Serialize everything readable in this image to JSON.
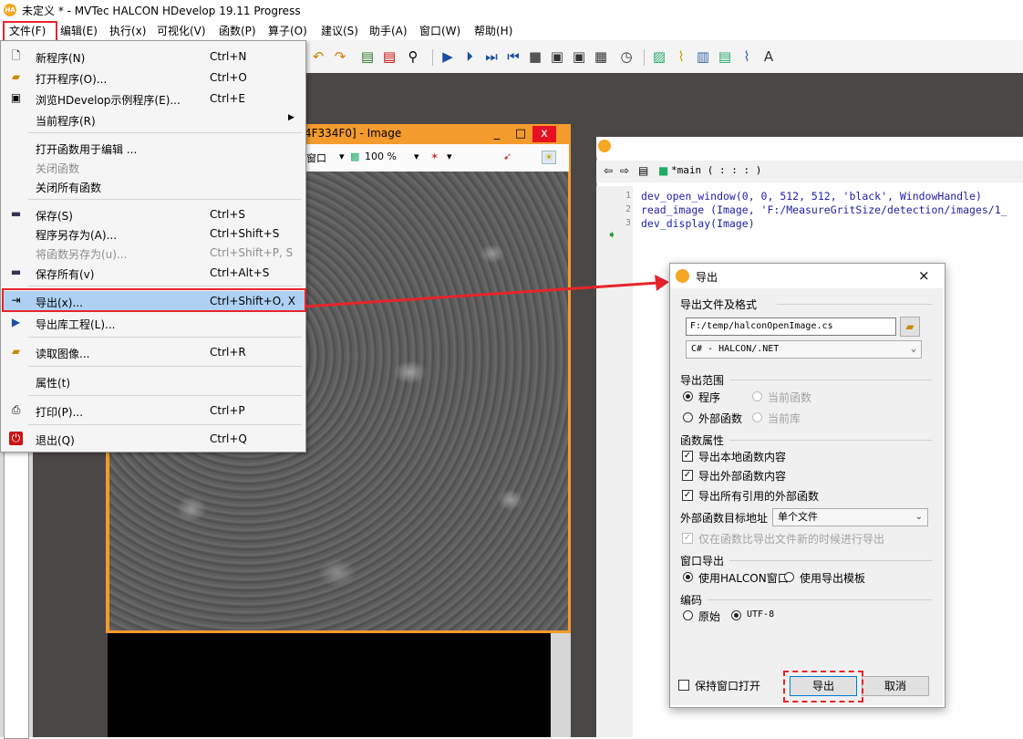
{
  "window": {
    "title": "未定义 * - MVTec HALCON HDevelop 19.11 Progress",
    "logo": "HA"
  },
  "menubar": [
    "文件(F)",
    "编辑(E)",
    "执行(x)",
    "可视化(V)",
    "函数(P)",
    "算子(O)",
    "建议(S)",
    "助手(A)",
    "窗口(W)",
    "帮助(H)"
  ],
  "file_menu": {
    "items": [
      {
        "label": "新程序(N)",
        "shortcut": "Ctrl+N",
        "icon": "new-file-icon"
      },
      {
        "label": "打开程序(O)...",
        "shortcut": "Ctrl+O",
        "icon": "open-folder-icon"
      },
      {
        "label": "浏览HDevelop示例程序(E)...",
        "shortcut": "Ctrl+E",
        "icon": "browse-examples-icon"
      },
      {
        "label": "当前程序(R)",
        "shortcut": "",
        "icon": ""
      },
      {
        "label": "打开函数用于编辑 ...",
        "shortcut": "",
        "icon": ""
      },
      {
        "label": "关闭函数",
        "shortcut": "",
        "icon": ""
      },
      {
        "label": "关闭所有函数",
        "shortcut": "",
        "icon": ""
      },
      {
        "label": "保存(S)",
        "shortcut": "Ctrl+S",
        "icon": "save-icon"
      },
      {
        "label": "程序另存为(A)...",
        "shortcut": "Ctrl+Shift+S",
        "icon": ""
      },
      {
        "label": "将函数另存为(u)...",
        "shortcut": "Ctrl+Shift+P, S",
        "icon": ""
      },
      {
        "label": "保存所有(v)",
        "shortcut": "Ctrl+Alt+S",
        "icon": "save-all-icon"
      },
      {
        "label": "导出(x)...",
        "shortcut": "Ctrl+Shift+O, X",
        "icon": "export-icon"
      },
      {
        "label": "导出库工程(L)...",
        "shortcut": "",
        "icon": "export-library-icon"
      },
      {
        "label": "读取图像...",
        "shortcut": "Ctrl+R",
        "icon": "read-image-icon"
      },
      {
        "label": "属性(t)",
        "shortcut": "",
        "icon": ""
      },
      {
        "label": "打印(P)...",
        "shortcut": "Ctrl+P",
        "icon": "print-icon"
      },
      {
        "label": "退出(Q)",
        "shortcut": "Ctrl+Q",
        "icon": "exit-icon"
      }
    ]
  },
  "image_window": {
    "title": "4F334F0] - Image",
    "window_menu_fragment": "窗口",
    "zoom": "100 %",
    "min_btn": "_",
    "max_btn": "□",
    "close_btn": "x"
  },
  "program_window": {
    "procedure": "*main ( : : : )",
    "lines": [
      {
        "no": "1",
        "code": "dev_open_window(0, 0, 512, 512, 'black', WindowHandle)"
      },
      {
        "no": "2",
        "code": "read_image (Image, 'F:/MeasureGritSize/detection/images/1_"
      },
      {
        "no": "3",
        "code": "dev_display(Image)"
      }
    ]
  },
  "export_dialog": {
    "title": "导出",
    "close": "×",
    "section_file": "导出文件及格式",
    "file_path": "F:/temp/halconOpenImage.cs",
    "format": "C# - HALCON/.NET",
    "section_range": "导出范围",
    "range_program": "程序",
    "range_current_proc": "当前函数",
    "range_external_proc": "外部函数",
    "range_current_lib": "当前库",
    "section_proc_props": "函数属性",
    "opt_local_proc": "导出本地函数内容",
    "opt_external_proc": "导出外部函数内容",
    "opt_all_referenced": "导出所有引用的外部函数",
    "external_target_label": "外部函数目标地址",
    "external_target_value": "单个文件",
    "opt_only_newer": "仅在函数比导出文件新的时候进行导出",
    "section_window": "窗口导出",
    "window_halcon": "使用HALCON窗口",
    "window_template": "使用导出模板",
    "section_encoding": "编码",
    "enc_original": "原始",
    "enc_utf8": "UTF-8",
    "keep_open": "保持窗口打开",
    "export_button": "导出",
    "cancel_button": "取消"
  },
  "colors": {
    "highlight_red": "#e8242b",
    "menu_selection": "#aed1f3",
    "image_window_frame": "#f39b2d",
    "workspace": "#4b4746"
  }
}
